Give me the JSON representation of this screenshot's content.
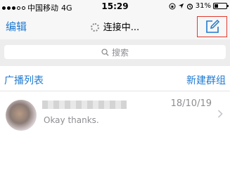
{
  "status_bar": {
    "carrier": "中国移动",
    "network": "4G",
    "time": "15:29",
    "battery": "31%"
  },
  "nav": {
    "edit_label": "编辑",
    "title": "连接中..."
  },
  "search": {
    "placeholder": "搜索"
  },
  "links": {
    "broadcast_list": "广播列表",
    "new_group": "新建群组"
  },
  "chats": [
    {
      "date": "18/10/19",
      "preview": "Okay thanks."
    }
  ],
  "colors": {
    "accent": "#1f7ad0",
    "highlight": "#e0392e"
  }
}
